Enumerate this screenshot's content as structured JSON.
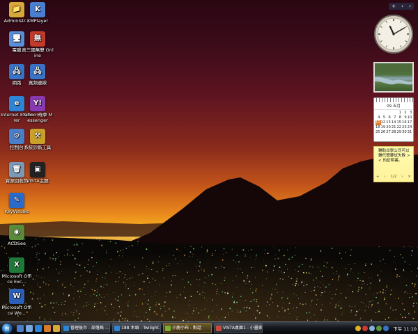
{
  "desktop": {
    "icons": [
      {
        "label": "Administr...",
        "icon": "folder-icon",
        "color": "#d9a83a",
        "glyph": "📁"
      },
      {
        "label": "KMPlayer",
        "icon": "kmplayer-icon",
        "color": "#4a7fd0",
        "glyph": "K"
      },
      {
        "label": "電腦",
        "icon": "computer-icon",
        "color": "#5a8fd8",
        "glyph": "🖥"
      },
      {
        "label": "真三國無雙 Online",
        "icon": "game-icon",
        "color": "#c23a2a",
        "glyph": "無"
      },
      {
        "label": "網路",
        "icon": "network-icon",
        "color": "#3a72c6",
        "glyph": "🖧"
      },
      {
        "label": "寬頻連線",
        "icon": "broadband-icon",
        "color": "#3a72c6",
        "glyph": "🖧"
      },
      {
        "label": "Internet Explorer",
        "icon": "internet-explorer-icon",
        "color": "#2f84d8",
        "glyph": "e"
      },
      {
        "label": "Yahoo!奇摩 Messenger",
        "icon": "yahoo-messenger-icon",
        "color": "#8a3ab0",
        "glyph": "Y!"
      },
      {
        "label": "控制台",
        "icon": "control-panel-icon",
        "color": "#4a7ec8",
        "glyph": "⚙"
      },
      {
        "label": "系統診斷工具",
        "icon": "diagnostic-tool-icon",
        "color": "#c8a02a",
        "glyph": "⚒"
      },
      {
        "label": "資源回收筒",
        "icon": "recycle-bin-icon",
        "color": "#7a9ab8",
        "glyph": "🗑"
      },
      {
        "label": "VISTA主題",
        "icon": "vista-theme-icon",
        "color": "#222222",
        "glyph": "▣"
      },
      {
        "label": "KeyVisuals",
        "icon": "keyvisuals-icon",
        "color": "#2a6ac8",
        "glyph": "✎"
      },
      {
        "label": "ACDSee",
        "icon": "acdsee-icon",
        "color": "#5a8a3a",
        "glyph": "◉"
      },
      {
        "label": "Microsoft Office Exc...",
        "icon": "excel-icon",
        "color": "#1f7a3a",
        "glyph": "X"
      },
      {
        "label": "Microsoft Office Wo...",
        "icon": "word-icon",
        "color": "#2b5fb8",
        "glyph": "W"
      }
    ]
  },
  "sidebar": {
    "controls": [
      "+",
      "‹",
      "›"
    ],
    "clock": {
      "hour": 11,
      "minute": 10
    },
    "calendar": {
      "header": "09 五月",
      "today": 11,
      "days": [
        "",
        "",
        "",
        "",
        "1",
        "2",
        "3",
        "4",
        "5",
        "6",
        "7",
        "8",
        "9",
        "10",
        "11",
        "12",
        "13",
        "14",
        "15",
        "16",
        "17",
        "18",
        "19",
        "20",
        "21",
        "22",
        "23",
        "24",
        "25",
        "26",
        "27",
        "28",
        "29",
        "30",
        "31"
      ]
    },
    "note": {
      "text": "輔助出學公司可以輔代簡要試失敗 >< 的証明書。",
      "page": "1/2",
      "add": "+",
      "prev": "‹",
      "next": "›",
      "close": "×"
    }
  },
  "taskbar": {
    "start_icon": "windows-logo-icon",
    "quick_launch": [
      {
        "icon": "show-desktop-icon",
        "color": "#4a7ec8"
      },
      {
        "icon": "switch-windows-icon",
        "color": "#7aa8e0"
      },
      {
        "icon": "ie-quick-icon",
        "color": "#2f84d8"
      },
      {
        "icon": "media-player-icon",
        "color": "#d87a2a"
      },
      {
        "icon": "folder-quick-icon",
        "color": "#d9a83a"
      }
    ],
    "tasks": [
      {
        "label": "管理後台 - 部落格 -...",
        "icon": "ie-task-icon",
        "color": "#2f84d8",
        "active": false
      },
      {
        "label": "188 木頭 - Twilight...",
        "icon": "ie-task-icon",
        "color": "#2f84d8",
        "active": false
      },
      {
        "label": "小鹿小布 - 對話",
        "icon": "messenger-task-icon",
        "color": "#7ab030",
        "active": true
      },
      {
        "label": "VISTA桌面1 - 小畫家",
        "icon": "paint-task-icon",
        "color": "#c84a3a",
        "active": false
      }
    ],
    "tray": [
      {
        "icon": "messenger-tray-icon",
        "color": "#e0b02a"
      },
      {
        "icon": "security-tray-icon",
        "color": "#c83a3a"
      },
      {
        "icon": "volume-tray-icon",
        "color": "#8ab0d8"
      },
      {
        "icon": "network-tray-icon",
        "color": "#5a9a3a"
      },
      {
        "icon": "language-tray-icon",
        "color": "#3a72c6"
      }
    ],
    "time": "下午 11:10"
  }
}
